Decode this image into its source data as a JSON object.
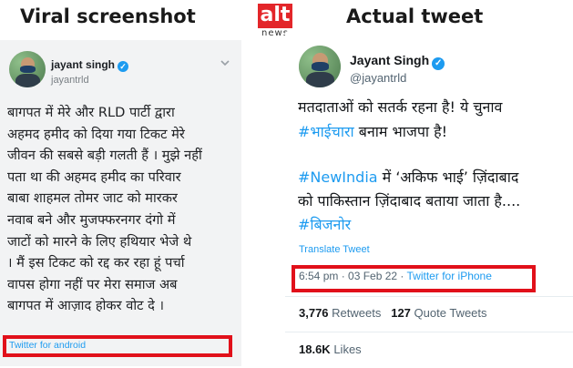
{
  "headings": {
    "left": "Viral screenshot",
    "right": "Actual tweet"
  },
  "logo": {
    "mark": "alt",
    "sub": "news"
  },
  "viral": {
    "name": "jayant singh",
    "handle": "jayantrld",
    "body": "बागपत में मेरे और RLD पार्टी द्वारा\nअहमद हमीद को दिया गया टिकट मेरे\nजीवन की सबसे बड़ी गलती हैं । मुझे नहीं\nपता था की अहमद हमीद का परिवार\nबाबा शाहमल तोमर जाट को मारकर\nनवाब बने और मुजफ्फरनगर दंगो में\nजाटों को मारने के लिए हथियार भेजे थे\n। मैं इस टिकट को रद्द कर रहा हूं पर्चा\nवापस होगा नहीं पर मेरा समाज अब\nबागपत में आज़ाद होकर वोट दे ।",
    "client": "Twitter for android"
  },
  "actual": {
    "name": "Jayant Singh",
    "handle": "@jayantrld",
    "line1": "मतदाताओं को सतर्क रहना है! ये चुनाव",
    "line2_tag": "#भाईचारा",
    "line2_rest": " बनाम भाजपा है!",
    "line3_tag": "#NewIndia",
    "line3_rest": " में ‘अकिफ भाई’ ज़िंदाबाद",
    "line4": "को पाकिस्तान ज़िंदाबाद बताया जाता है.... ",
    "line5_tag": "#बिजनोर",
    "translate": "Translate Tweet",
    "time": "6:54 pm · 03 Feb 22 · ",
    "client": "Twitter for iPhone",
    "retweets_count": "3,776",
    "retweets_label": "Retweets",
    "quotes_count": "127",
    "quotes_label": "Quote Tweets",
    "likes_count": "18.6K",
    "likes_label": "Likes"
  },
  "colors": {
    "link": "#1d9bf0",
    "highlight": "#e1101a",
    "verified": "#1d9bf0"
  }
}
